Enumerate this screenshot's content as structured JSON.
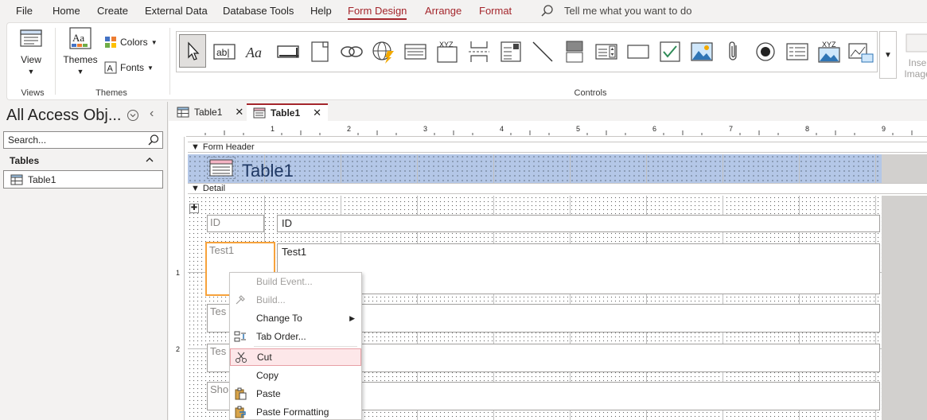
{
  "menu": {
    "items": [
      "File",
      "Home",
      "Create",
      "External Data",
      "Database Tools",
      "Help",
      "Form Design",
      "Arrange",
      "Format"
    ],
    "active": "Form Design",
    "tell_me": "Tell me what you want to do"
  },
  "ribbon": {
    "view_label": "View",
    "views_group": "Views",
    "themes_label": "Themes",
    "colors_label": "Colors",
    "fonts_label": "Fonts",
    "themes_group": "Themes",
    "controls_group": "Controls",
    "insert_image_label": "Inse\nImage",
    "controls": [
      "select-pointer-icon",
      "textbox-icon",
      "label-icon",
      "button-icon",
      "tab-control-icon",
      "hyperlink-icon",
      "web-browser-icon",
      "navigation-control-icon",
      "option-group-icon",
      "page-break-icon",
      "combo-box-icon",
      "line-icon",
      "toggle-button-icon",
      "list-box-icon",
      "rectangle-icon",
      "checkbox-icon",
      "image-icon",
      "attachment-icon",
      "option-button-icon",
      "subform-icon",
      "bound-object-frame-icon",
      "chart-icon"
    ]
  },
  "nav": {
    "title": "All Access Obj...",
    "search_placeholder": "Search...",
    "section": "Tables",
    "items": [
      {
        "label": "Table1"
      }
    ]
  },
  "doc_tabs": [
    {
      "label": "Table1",
      "active": false
    },
    {
      "label": "Table1",
      "active": true
    }
  ],
  "design": {
    "ruler_marks": [
      "1",
      "2",
      "3",
      "4",
      "5",
      "6",
      "7",
      "8",
      "9"
    ],
    "vruler_marks": [
      "1",
      "2"
    ],
    "form_header_label": "Form Header",
    "detail_label": "Detail",
    "form_title": "Table1",
    "fields": [
      {
        "label": "ID",
        "value": "ID"
      },
      {
        "label": "Test1",
        "value": "Test1"
      },
      {
        "label": "Tes",
        "value": ""
      },
      {
        "label": "Tes",
        "value": ""
      },
      {
        "label": "Sho",
        "value": ""
      }
    ]
  },
  "context_menu": {
    "items": [
      {
        "label": "Build Event...",
        "disabled": true,
        "icon": ""
      },
      {
        "label": "Build...",
        "disabled": true,
        "icon": "build-icon"
      },
      {
        "label": "Change To",
        "disabled": false,
        "icon": "",
        "submenu": true
      },
      {
        "label": "Tab Order...",
        "disabled": false,
        "icon": "tab-order-icon"
      },
      {
        "label": "Cut",
        "disabled": false,
        "icon": "scissors-icon",
        "highlighted": true
      },
      {
        "label": "Copy",
        "disabled": false,
        "icon": ""
      },
      {
        "label": "Paste",
        "disabled": false,
        "icon": "paste-icon"
      },
      {
        "label": "Paste Formatting",
        "disabled": false,
        "icon": "paste-formatting-icon"
      }
    ]
  },
  "colors": {
    "accent": "#a4262c",
    "header_fill": "#b4c7e7",
    "selection": "#f7a23b"
  }
}
